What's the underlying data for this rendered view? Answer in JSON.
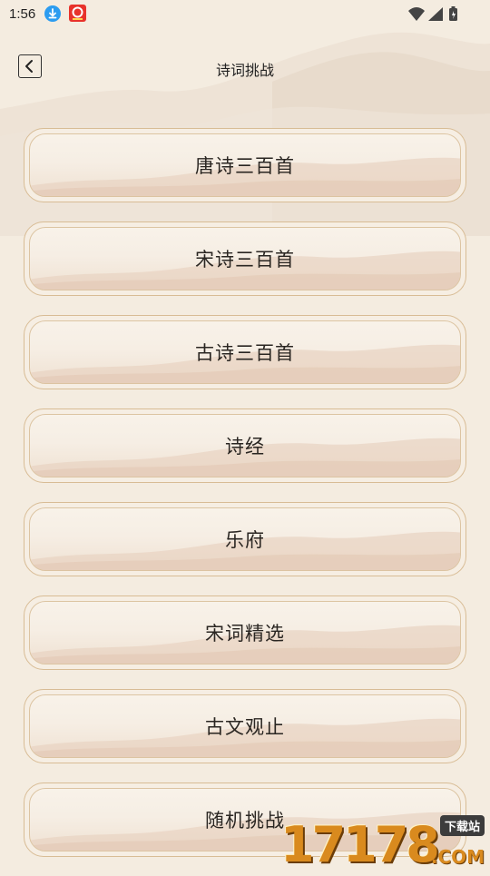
{
  "status_bar": {
    "time": "1:56",
    "icons": [
      "download-icon",
      "app-notification-icon",
      "wifi-icon",
      "cellular-signal-icon",
      "battery-icon"
    ]
  },
  "header": {
    "back_icon": "chevron-left-icon",
    "title": "诗词挑战"
  },
  "menu": {
    "items": [
      {
        "label": "唐诗三百首"
      },
      {
        "label": "宋诗三百首"
      },
      {
        "label": "古诗三百首"
      },
      {
        "label": "诗经"
      },
      {
        "label": "乐府"
      },
      {
        "label": "宋词精选"
      },
      {
        "label": "古文观止"
      },
      {
        "label": "随机挑战"
      }
    ]
  },
  "watermark": {
    "digits": "17178",
    "badge": "下载站",
    "suffix": ".COM"
  },
  "colors": {
    "background": "#f4ece0",
    "card_border": "#d8bc95",
    "text": "#2a2622",
    "watermark": "#d98a1e"
  }
}
